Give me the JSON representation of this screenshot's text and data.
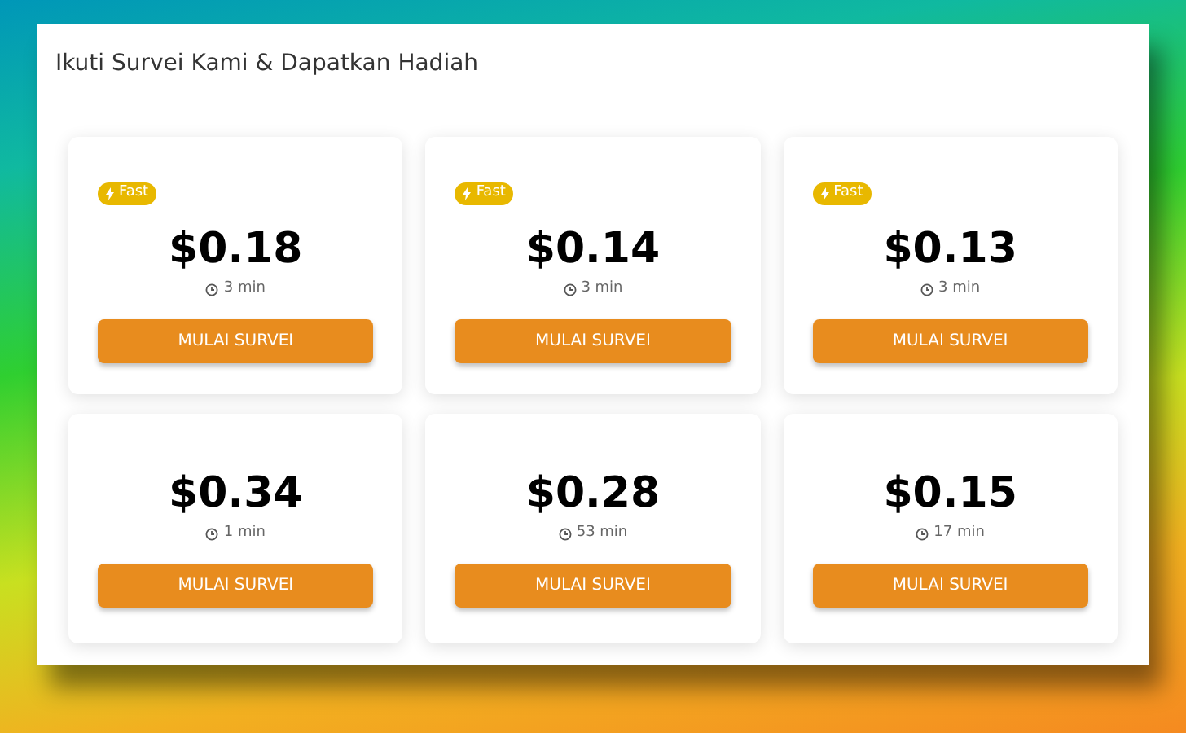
{
  "title": "Ikuti Survei Kami & Dapatkan Hadiah",
  "surveys": [
    {
      "badge": "Fast",
      "price": "$0.18",
      "duration": "3 min",
      "button": "MULAI SURVEI"
    },
    {
      "badge": "Fast",
      "price": "$0.14",
      "duration": "3 min",
      "button": "MULAI SURVEI"
    },
    {
      "badge": "Fast",
      "price": "$0.13",
      "duration": "3 min",
      "button": "MULAI SURVEI"
    },
    {
      "price": "$0.34",
      "duration": "1 min",
      "button": "MULAI SURVEI"
    },
    {
      "price": "$0.28",
      "duration": "53 min",
      "button": "MULAI SURVEI"
    },
    {
      "price": "$0.15",
      "duration": "17 min",
      "button": "MULAI SURVEI"
    }
  ]
}
